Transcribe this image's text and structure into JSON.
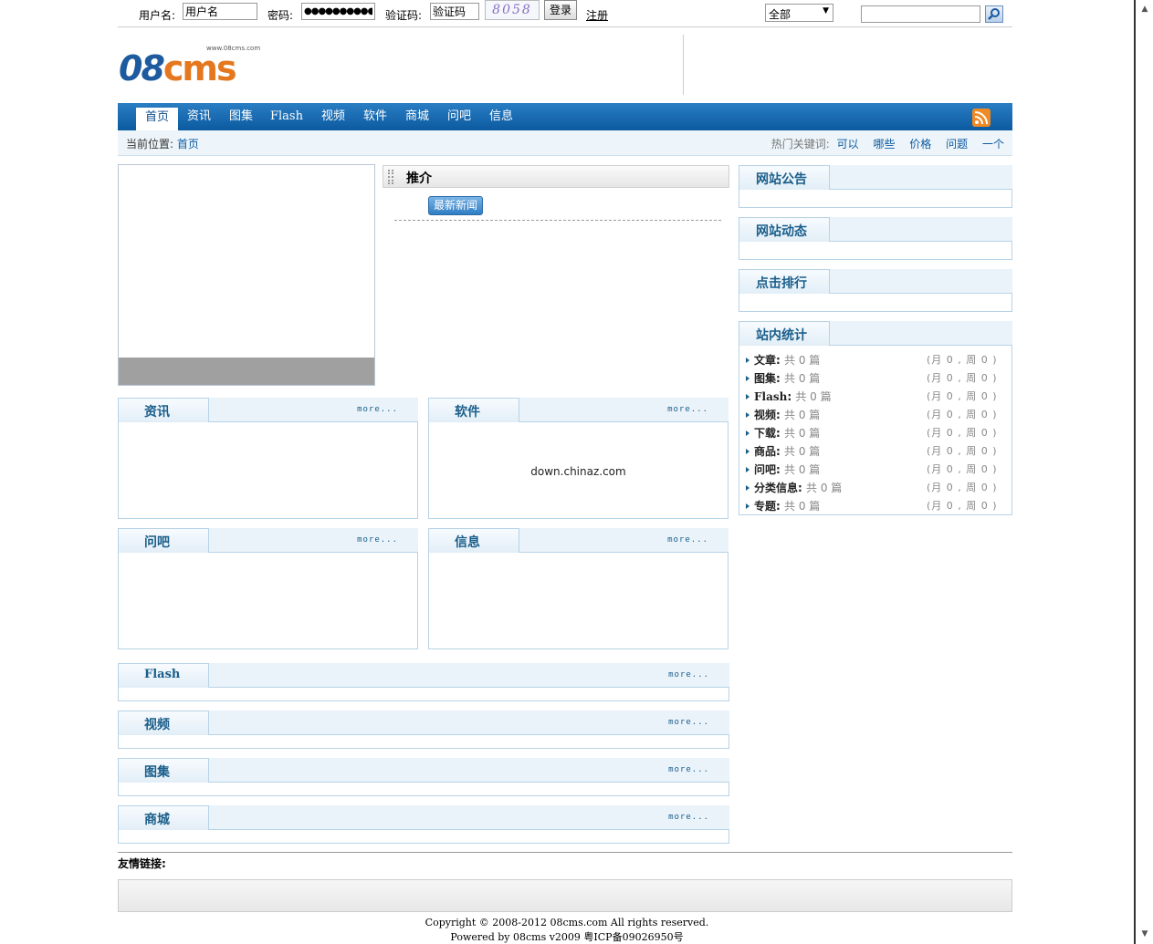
{
  "topbar": {
    "username_label": "用户名:",
    "username_value": "用户名",
    "password_label": "密码:",
    "password_value": "●●●●●●●●●●●",
    "captcha_label": "验证码:",
    "captcha_value": "验证码",
    "captcha_image_text": "8058",
    "login_label": "登录",
    "register_label": "注册",
    "category_selected": "全部",
    "search_value": ""
  },
  "logo": {
    "url_text": "www.08cms.com",
    "part1": "08",
    "part2": "CMS"
  },
  "nav": {
    "items": [
      "首页",
      "资讯",
      "图集",
      "Flash",
      "视频",
      "软件",
      "商城",
      "问吧",
      "信息"
    ],
    "active": "首页"
  },
  "breadcrumb": {
    "label": "当前位置:",
    "current": "首页",
    "hot_label": "热门关键词:",
    "keywords": [
      "可以",
      "哪些",
      "价格",
      "问题",
      "一个"
    ]
  },
  "recommend": {
    "title": "推介",
    "news_button": "最新新闻"
  },
  "more_label": "more...",
  "modules": {
    "news": {
      "title": "资讯"
    },
    "software": {
      "title": "软件",
      "content": "down.chinaz.com"
    },
    "ask": {
      "title": "问吧"
    },
    "info": {
      "title": "信息"
    },
    "flash": {
      "title": "Flash"
    },
    "video": {
      "title": "视频"
    },
    "gallery": {
      "title": "图集"
    },
    "shop": {
      "title": "商城"
    }
  },
  "sidebar": {
    "notice": {
      "title": "网站公告"
    },
    "dynamics": {
      "title": "网站动态"
    },
    "ranking": {
      "title": "点击排行"
    },
    "stats": {
      "title": "站内统计",
      "rows": [
        {
          "name": "文章",
          "count": "共 0 篇",
          "period": "(月 0 , 周 0 )"
        },
        {
          "name": "图集",
          "count": "共 0 篇",
          "period": "(月 0 , 周 0 )"
        },
        {
          "name": "Flash",
          "count": "共 0 篇",
          "period": "(月 0 , 周 0 )"
        },
        {
          "name": "视频",
          "count": "共 0 篇",
          "period": "(月 0 , 周 0 )"
        },
        {
          "name": "下载",
          "count": "共 0 篇",
          "period": "(月 0 , 周 0 )"
        },
        {
          "name": "商品",
          "count": "共 0 篇",
          "period": "(月 0 , 周 0 )"
        },
        {
          "name": "问吧",
          "count": "共 0 篇",
          "period": "(月 0 , 周 0 )"
        },
        {
          "name": "分类信息",
          "count": "共 0 篇",
          "period": "(月 0 , 周 0 )"
        },
        {
          "name": "专题",
          "count": "共 0 篇",
          "period": "(月 0 , 周 0 )"
        }
      ]
    }
  },
  "footer": {
    "links_title": "友情链接:",
    "copyright": "Copyright © 2008-2012 08cms.com All rights reserved.",
    "powered": "Powered by 08cms v2009 粤ICP备09026950号"
  },
  "colors": {
    "nav_blue": "#1a6eb5",
    "logo_blue": "#1d5a9e",
    "logo_orange": "#e5781e",
    "title_blue": "#1a5e8a"
  }
}
